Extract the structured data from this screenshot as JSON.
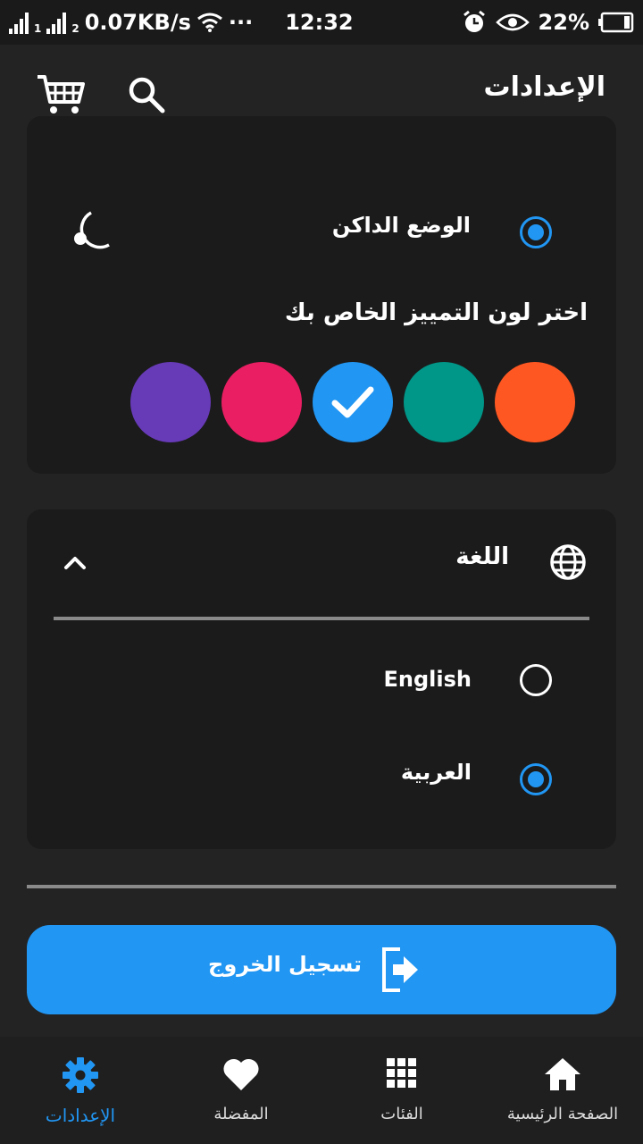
{
  "status_bar": {
    "sim1": "1",
    "sim2": "2",
    "speed": "0.07KB/s",
    "dots": "···",
    "time": "12:32",
    "battery": "22%"
  },
  "app_bar": {
    "title": "الإعدادات"
  },
  "theme": {
    "dark_mode_label": "الوضع الداكن",
    "dark_mode_selected": true,
    "accent_title": "اختر لون التمييز الخاص بك",
    "accent_colors": [
      "#ff5722",
      "#009688",
      "#2196f3",
      "#e91e63",
      "#673ab7"
    ],
    "selected_accent": "#2196f3"
  },
  "language": {
    "title": "اللغة",
    "options": [
      {
        "label": "English",
        "selected": false
      },
      {
        "label": "العربية",
        "selected": true
      }
    ]
  },
  "logout": {
    "label": "تسجيل الخروج"
  },
  "bottom_nav": {
    "items": [
      {
        "label": "الصفحة الرئيسية",
        "icon": "home-icon",
        "active": false
      },
      {
        "label": "الفئات",
        "icon": "grid-icon",
        "active": false
      },
      {
        "label": "المفضلة",
        "icon": "heart-icon",
        "active": false
      },
      {
        "label": "الإعدادات",
        "icon": "gear-icon",
        "active": true
      }
    ]
  },
  "colors": {
    "accent": "#2196f3",
    "background": "#232323",
    "card": "#1b1b1b"
  }
}
